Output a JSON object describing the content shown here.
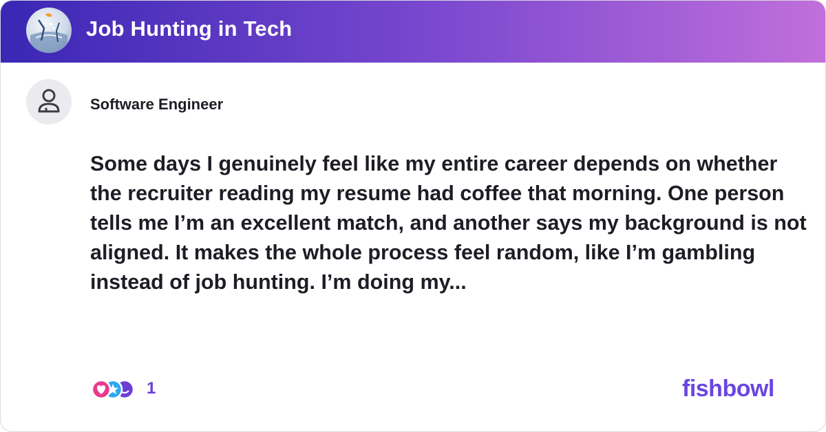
{
  "header": {
    "title": "Job Hunting in Tech"
  },
  "post": {
    "author": "Software Engineer",
    "text": "Some days I genuinely feel like my entire career depends on whether the recruiter reading my resume had coffee that morning. One person tells me I’m an excellent match, and another says my background is not aligned. It makes the whole process feel random, like I’m gambling instead of job hunting. I’m doing my..."
  },
  "reactions": {
    "count": "1",
    "icons": [
      "heart-reaction-icon",
      "star-reaction-icon",
      "smile-reaction-icon"
    ]
  },
  "brand": {
    "logo_text": "fishbowl",
    "accent": "#6b45e0",
    "header_gradient": [
      "#3a27b5",
      "#7d4ad0",
      "#c16fdb"
    ]
  }
}
